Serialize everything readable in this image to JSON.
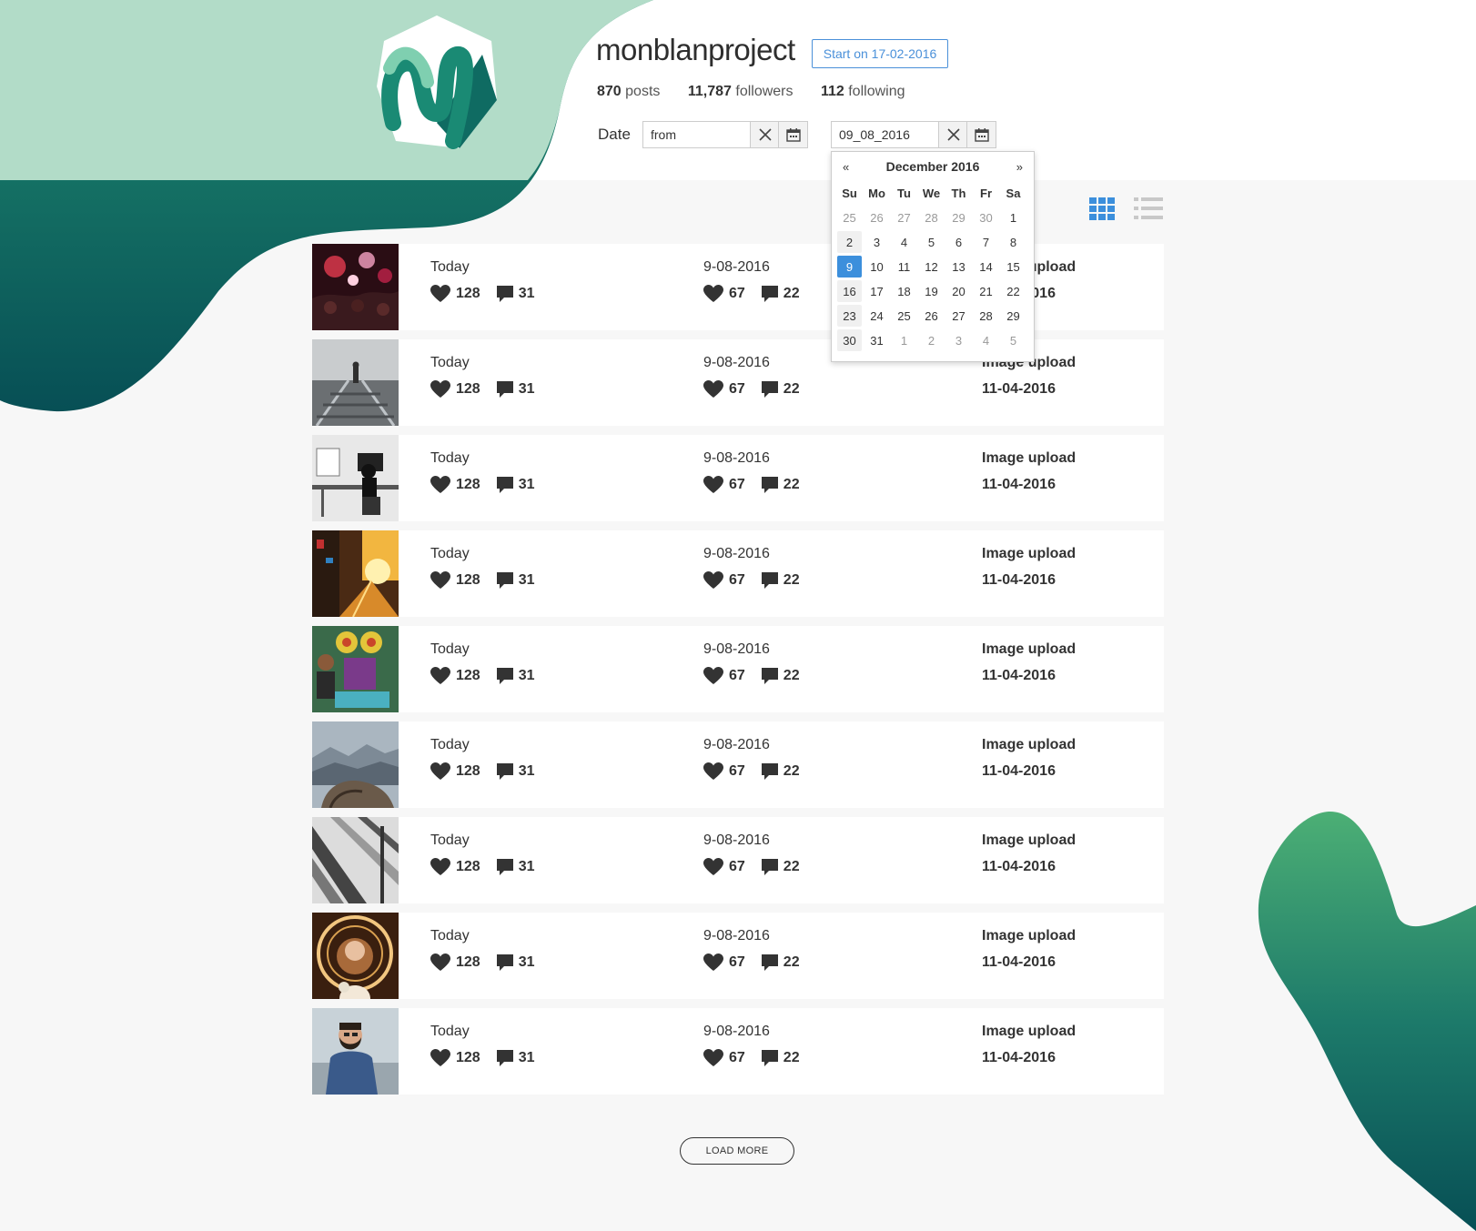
{
  "profile": {
    "username": "monblanproject",
    "start_badge": "Start on 17-02-2016",
    "stats": [
      {
        "value": "870",
        "label": "posts"
      },
      {
        "value": "11,787",
        "label": "followers"
      },
      {
        "value": "112",
        "label": "following"
      }
    ]
  },
  "filter": {
    "date_label": "Date",
    "from_value": "from",
    "to_value": "09_08_2016"
  },
  "calendar": {
    "month_label": "December 2016",
    "prev": "«",
    "next": "»",
    "weekdays": [
      "Su",
      "Mo",
      "Tu",
      "We",
      "Th",
      "Fr",
      "Sa"
    ],
    "weeks": [
      [
        "25",
        "26",
        "27",
        "28",
        "29",
        "30",
        "1"
      ],
      [
        "2",
        "3",
        "4",
        "5",
        "6",
        "7",
        "8"
      ],
      [
        "9",
        "10",
        "11",
        "12",
        "13",
        "14",
        "15"
      ],
      [
        "16",
        "17",
        "18",
        "19",
        "20",
        "21",
        "22"
      ],
      [
        "23",
        "24",
        "25",
        "26",
        "27",
        "28",
        "29"
      ],
      [
        "30",
        "31",
        "1",
        "2",
        "3",
        "4",
        "5"
      ]
    ],
    "selected": "9"
  },
  "posts": [
    {
      "period1": "Today",
      "likes1": "128",
      "comments1": "31",
      "period2": "9-08-2016",
      "likes2": "67",
      "comments2": "22",
      "type": "Image upload",
      "date": "11-04-2016",
      "thumb": "concert"
    },
    {
      "period1": "Today",
      "likes1": "128",
      "comments1": "31",
      "period2": "9-08-2016",
      "likes2": "67",
      "comments2": "22",
      "type": "Image upload",
      "date": "11-04-2016",
      "thumb": "railway"
    },
    {
      "period1": "Today",
      "likes1": "128",
      "comments1": "31",
      "period2": "9-08-2016",
      "likes2": "67",
      "comments2": "22",
      "type": "Image upload",
      "date": "11-04-2016",
      "thumb": "office"
    },
    {
      "period1": "Today",
      "likes1": "128",
      "comments1": "31",
      "period2": "9-08-2016",
      "likes2": "67",
      "comments2": "22",
      "type": "Image upload",
      "date": "11-04-2016",
      "thumb": "street"
    },
    {
      "period1": "Today",
      "likes1": "128",
      "comments1": "31",
      "period2": "9-08-2016",
      "likes2": "67",
      "comments2": "22",
      "type": "Image upload",
      "date": "11-04-2016",
      "thumb": "market"
    },
    {
      "period1": "Today",
      "likes1": "128",
      "comments1": "31",
      "period2": "9-08-2016",
      "likes2": "67",
      "comments2": "22",
      "type": "Image upload",
      "date": "11-04-2016",
      "thumb": "mountains"
    },
    {
      "period1": "Today",
      "likes1": "128",
      "comments1": "31",
      "period2": "9-08-2016",
      "likes2": "67",
      "comments2": "22",
      "type": "Image upload",
      "date": "11-04-2016",
      "thumb": "architecture"
    },
    {
      "period1": "Today",
      "likes1": "128",
      "comments1": "31",
      "period2": "9-08-2016",
      "likes2": "67",
      "comments2": "22",
      "type": "Image upload",
      "date": "11-04-2016",
      "thumb": "woman-lights"
    },
    {
      "period1": "Today",
      "likes1": "128",
      "comments1": "31",
      "period2": "9-08-2016",
      "likes2": "67",
      "comments2": "22",
      "type": "Image upload",
      "date": "11-04-2016",
      "thumb": "bearded-man"
    }
  ],
  "load_more_label": "LOAD MORE",
  "icons": {
    "like": "heart-icon",
    "comment": "comment-icon",
    "grid_view": "grid-view-icon",
    "list_view": "list-view-icon",
    "clear": "clear-icon",
    "calendar": "calendar-icon"
  },
  "colors": {
    "accent_blue": "#3c8fdc",
    "brand_green_light": "#b2dcc8",
    "brand_green_dark": "#0d5a56",
    "text": "#333333"
  }
}
